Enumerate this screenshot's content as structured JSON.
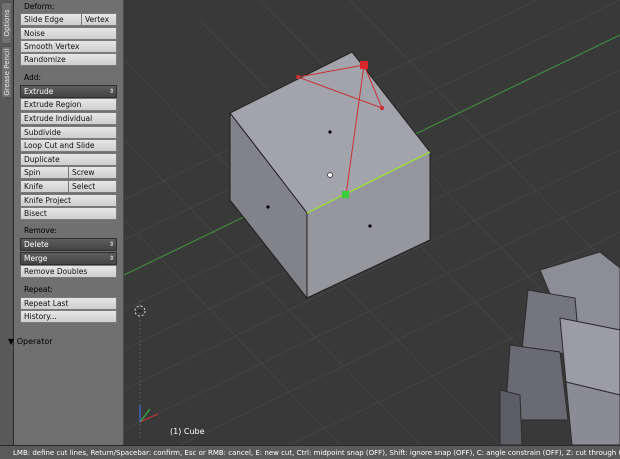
{
  "tabs": [
    "Options",
    "Grease Pencil"
  ],
  "deform": {
    "label": "Deform:",
    "slide_edge": "Slide Edge",
    "vertex": "Vertex",
    "noise": "Noise",
    "smooth_vertex": "Smooth Vertex",
    "randomize": "Randomize"
  },
  "add": {
    "label": "Add:",
    "extrude": "Extrude",
    "extrude_region": "Extrude Region",
    "extrude_individual": "Extrude Individual",
    "subdivide": "Subdivide",
    "loop_cut": "Loop Cut and Slide",
    "duplicate": "Duplicate",
    "spin": "Spin",
    "screw": "Screw",
    "knife": "Knife",
    "select": "Select",
    "knife_project": "Knife Project",
    "bisect": "Bisect"
  },
  "remove": {
    "label": "Remove:",
    "delete": "Delete",
    "merge": "Merge",
    "remove_doubles": "Remove Doubles"
  },
  "repeat": {
    "label": "Repeat:",
    "repeat_last": "Repeat Last",
    "history": "History..."
  },
  "operator": {
    "label": "Operator",
    "arrow": "▼"
  },
  "viewport": {
    "object_label": "(1) Cube"
  },
  "status": "LMB: define cut lines, Return/Spacebar: confirm, Esc or RMB: cancel, E: new cut, Ctrl: midpoint snap (OFF), Shift: ignore snap (OFF), C: angle constrain (OFF), Z: cut through (OFF)",
  "colors": {
    "viewport_bg": "#393939",
    "toolshelf_bg": "#707070",
    "cut_line": "#c83232",
    "edge_highlight": "#9be043",
    "x_axis": "#3b9a3b"
  }
}
